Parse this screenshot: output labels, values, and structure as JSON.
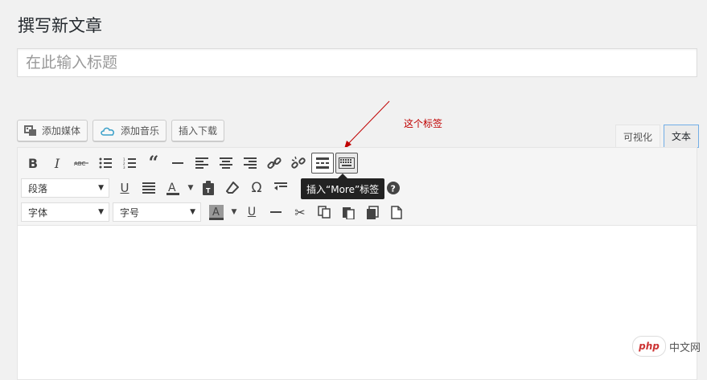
{
  "page": {
    "heading": "撰写新文章"
  },
  "title": {
    "placeholder": "在此输入标题"
  },
  "media_buttons": {
    "add_media": "添加媒体",
    "add_music": "添加音乐",
    "insert_download": "插入下载"
  },
  "annotation": {
    "text": "这个标签",
    "color": "#c00000"
  },
  "mode_tabs": {
    "visual": "可视化",
    "text": "文本"
  },
  "toolbar": {
    "format_select": "段落",
    "font_select": "字体",
    "size_select": "字号"
  },
  "tooltip": {
    "text": "插入“More”标签"
  },
  "watermark": {
    "logo": "php",
    "text": "中文网"
  },
  "colors": {
    "accent": "#72aee6",
    "annotation": "#c00000"
  }
}
